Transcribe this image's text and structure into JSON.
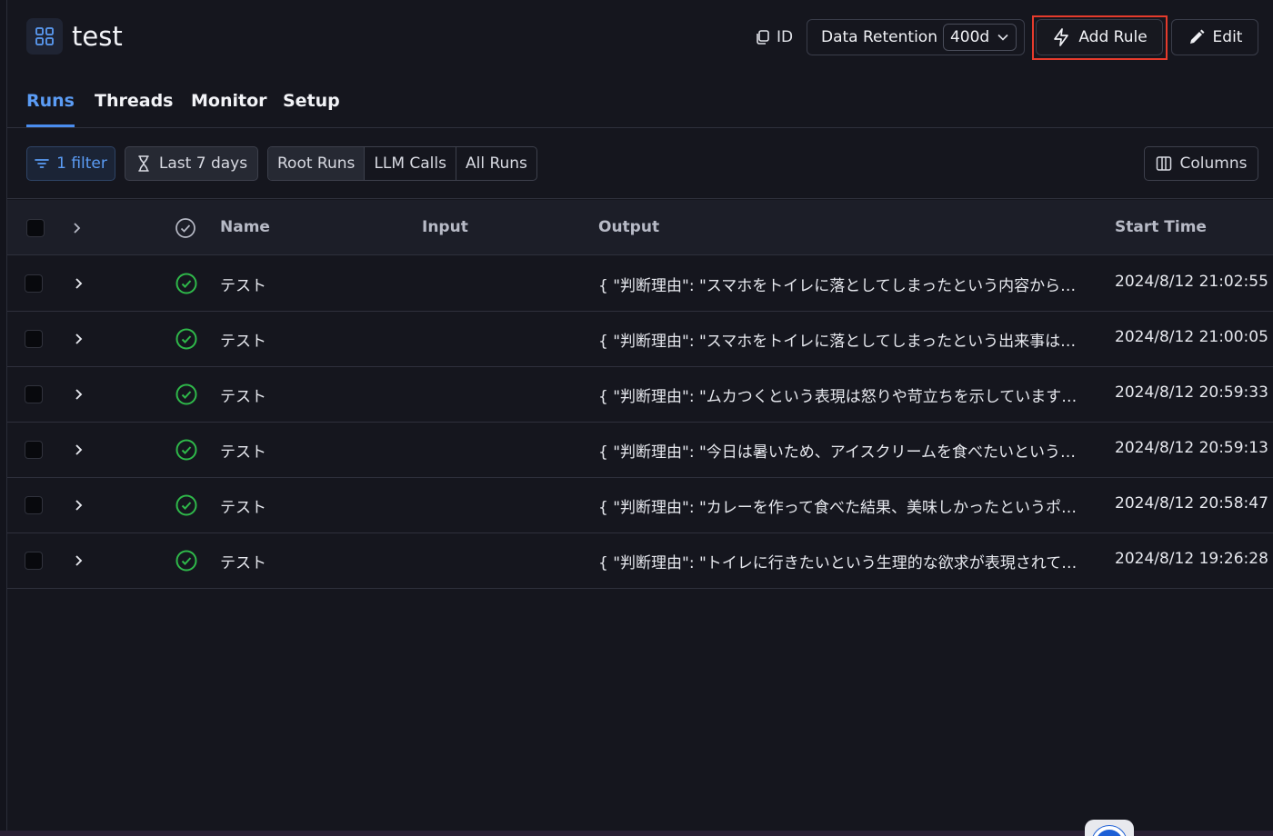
{
  "header": {
    "project_title": "test",
    "id_label": "ID",
    "retention_label": "Data Retention",
    "retention_value": "400d",
    "add_rule_label": "Add Rule",
    "edit_label": "Edit"
  },
  "tabs": [
    {
      "label": "Runs",
      "active": true
    },
    {
      "label": "Threads",
      "active": false
    },
    {
      "label": "Monitor",
      "active": false
    },
    {
      "label": "Setup",
      "active": false
    }
  ],
  "toolbar": {
    "filter_label": "1 filter",
    "date_label": "Last 7 days",
    "segments": [
      {
        "label": "Root Runs",
        "active": true
      },
      {
        "label": "LLM Calls",
        "active": false
      },
      {
        "label": "All Runs",
        "active": false
      }
    ],
    "columns_label": "Columns"
  },
  "table": {
    "columns": {
      "name": "Name",
      "input": "Input",
      "output": "Output",
      "start_time": "Start Time"
    },
    "rows": [
      {
        "name": "テスト",
        "input": "",
        "output": "{ \"判断理由\": \"スマホをトイレに落としてしまったという内容から…",
        "start_time": "2024/8/12 21:02:55",
        "status": "success"
      },
      {
        "name": "テスト",
        "input": "",
        "output": "{ \"判断理由\": \"スマホをトイレに落としてしまったという出来事は…",
        "start_time": "2024/8/12 21:00:05",
        "status": "success"
      },
      {
        "name": "テスト",
        "input": "",
        "output": "{ \"判断理由\": \"ムカつくという表現は怒りや苛立ちを示しています…",
        "start_time": "2024/8/12 20:59:33",
        "status": "success"
      },
      {
        "name": "テスト",
        "input": "",
        "output": "{ \"判断理由\": \"今日は暑いため、アイスクリームを食べたいという…",
        "start_time": "2024/8/12 20:59:13",
        "status": "success"
      },
      {
        "name": "テスト",
        "input": "",
        "output": "{ \"判断理由\": \"カレーを作って食べた結果、美味しかったというポ…",
        "start_time": "2024/8/12 20:58:47",
        "status": "success"
      },
      {
        "name": "テスト",
        "input": "",
        "output": "{ \"判断理由\": \"トイレに行きたいという生理的な欲求が表現されて…",
        "start_time": "2024/8/12 19:26:28",
        "status": "success"
      }
    ]
  },
  "colors": {
    "accent": "#5b9cf5",
    "success": "#2fb84a",
    "highlight": "#e53b2c",
    "background": "#15161e"
  },
  "icons": {
    "project": "grid-icon",
    "id": "copy-icon",
    "add_rule": "lightning-icon",
    "edit": "pencil-icon",
    "filter": "filter-icon",
    "date": "hourglass-icon",
    "columns": "columns-icon",
    "status": "check-circle-icon",
    "expand": "chevron-right-icon"
  }
}
